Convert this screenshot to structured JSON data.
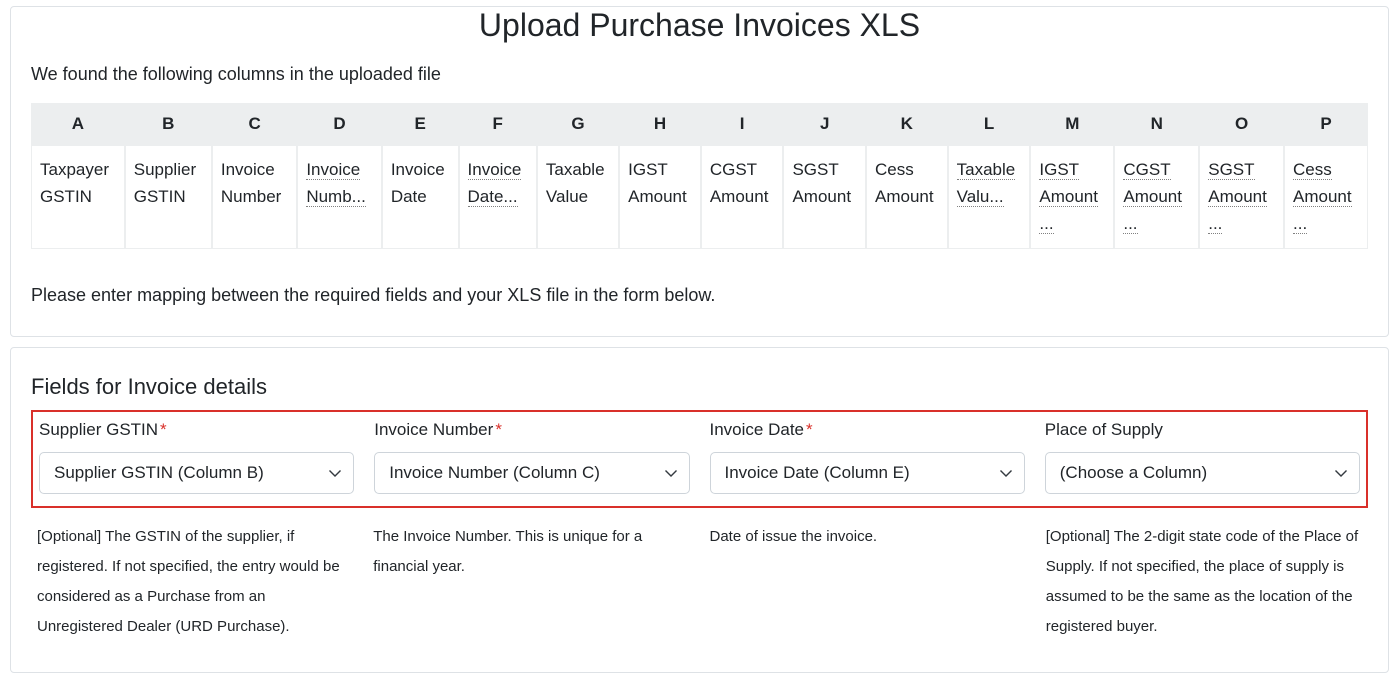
{
  "title": "Upload Purchase Invoices XLS",
  "intro": "We found the following columns in the uploaded file",
  "columns_table": {
    "headers": [
      "A",
      "B",
      "C",
      "D",
      "E",
      "F",
      "G",
      "H",
      "I",
      "J",
      "K",
      "L",
      "M",
      "N",
      "O",
      "P"
    ],
    "row1": [
      {
        "text": "Taxpayer GSTIN",
        "dotted": false
      },
      {
        "text": "Supplier GSTIN",
        "dotted": false
      },
      {
        "text": "Invoice Number",
        "dotted": false
      },
      {
        "text": "Invoice Numb...",
        "dotted": true
      },
      {
        "text": "Invoice Date",
        "dotted": false
      },
      {
        "text": "Invoice Date...",
        "dotted": true
      },
      {
        "text": "Taxable Value",
        "dotted": false
      },
      {
        "text": "IGST Amount",
        "dotted": false
      },
      {
        "text": "CGST Amount",
        "dotted": false
      },
      {
        "text": "SGST Amount",
        "dotted": false
      },
      {
        "text": "Cess Amount",
        "dotted": false
      },
      {
        "text": "Taxable Valu...",
        "dotted": true
      },
      {
        "text": "IGST Amount ...",
        "dotted": true
      },
      {
        "text": "CGST Amount ...",
        "dotted": true
      },
      {
        "text": "SGST Amount ...",
        "dotted": true
      },
      {
        "text": "Cess Amount ...",
        "dotted": true
      }
    ]
  },
  "mapping_line": "Please enter mapping between the required fields and your XLS file in the form below.",
  "section_title": "Fields for Invoice details",
  "fields": {
    "supplier_gstin": {
      "label": "Supplier GSTIN",
      "required": true,
      "value": "Supplier GSTIN (Column B)",
      "help": "[Optional] The GSTIN of the supplier, if registered. If not specified, the entry would be considered as a Purchase from an Unregistered Dealer (URD Purchase)."
    },
    "invoice_number": {
      "label": "Invoice Number",
      "required": true,
      "value": "Invoice Number (Column C)",
      "help": "The Invoice Number. This is unique for a financial year."
    },
    "invoice_date": {
      "label": "Invoice Date",
      "required": true,
      "value": "Invoice Date (Column E)",
      "help": "Date of issue the invoice."
    },
    "place_of_supply": {
      "label": "Place of Supply",
      "required": false,
      "value": "(Choose a Column)",
      "help": "[Optional] The 2-digit state code of the Place of Supply. If not specified, the place of supply is assumed to be the same as the location of the registered buyer."
    }
  },
  "required_marker": "*"
}
